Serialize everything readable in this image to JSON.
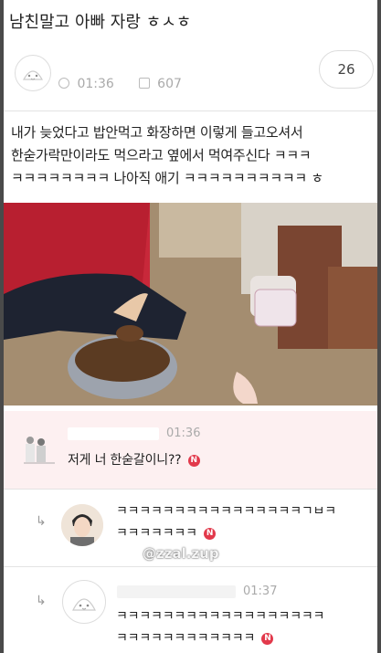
{
  "post": {
    "title": "남친말고 아빠 자랑 ㅎㅅㅎ",
    "time": "01:36",
    "views": "607",
    "comment_count": "26",
    "body_lines": [
      "내가 늦었다고 밥안먹고 화장하면 이렇게 들고오셔서",
      "한숟가락만이라도 먹으라고 옆에서 먹여주신다 ㅋㅋㅋ",
      "ㅋㅋㅋㅋㅋㅋㅋㅋ 나아직 애기 ㅋㅋㅋㅋㅋㅋㅋㅋㅋㅋ ㅎ"
    ]
  },
  "comments": [
    {
      "time": "01:36",
      "text": "저게 너 한숟갈이니??",
      "badge": "N"
    },
    {
      "line1": "ㅋㅋㅋㅋㅋㅋㅋㅋㅋㅋㅋㅋㅋㅋㅋㅋㄱㅂㅋ",
      "line2": "ㅋㅋㅋㅋㅋㅋㅋ",
      "badge": "N"
    },
    {
      "time": "01:37",
      "line1": "ㅋㅋㅋㅋㅋㅋㅋㅋㅋㅋㅋㅋㅋㅋㅋㅋㅋㅋ",
      "line2": "ㅋㅋㅋㅋㅋㅋㅋㅋㅋㅋㅋㅋ",
      "badge": "N"
    }
  ],
  "watermark": "@zzal.zup",
  "reply_arrow": "↳",
  "icons": [
    "clock-icon",
    "views-icon",
    "reply-arrow-icon",
    "new-badge-icon"
  ]
}
